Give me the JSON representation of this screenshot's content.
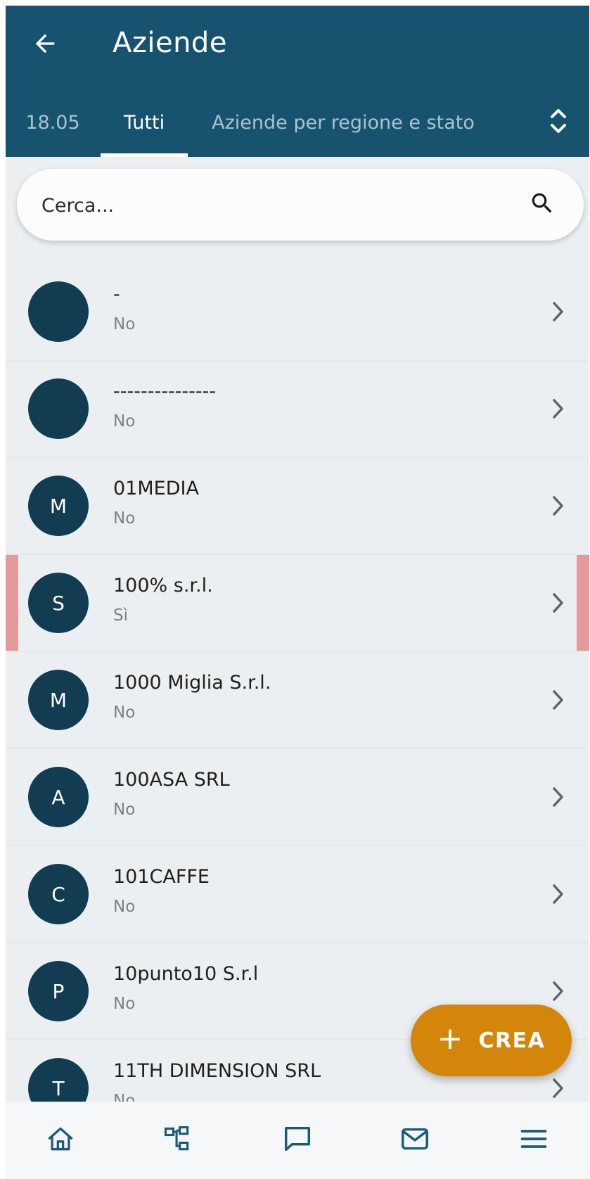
{
  "header": {
    "title": "Aziende",
    "back_icon": "arrow-left-icon"
  },
  "tabs": [
    {
      "label": "18.05",
      "active": false
    },
    {
      "label": "Tutti",
      "active": true
    },
    {
      "label": "Aziende per regione e stato",
      "active": false
    }
  ],
  "tab_sort_icon": "unfold-chevrons-icon",
  "search": {
    "placeholder": "Cerca...",
    "value": "",
    "icon": "search-icon"
  },
  "list": [
    {
      "avatar": "",
      "name": "-",
      "sub": "No",
      "flagged": false
    },
    {
      "avatar": "",
      "name": "---------------",
      "sub": "No",
      "flagged": false
    },
    {
      "avatar": "M",
      "name": "01MEDIA",
      "sub": "No",
      "flagged": false
    },
    {
      "avatar": "S",
      "name": "100% s.r.l.",
      "sub": "Sì",
      "flagged": true
    },
    {
      "avatar": "M",
      "name": "1000 Miglia S.r.l.",
      "sub": "No",
      "flagged": false
    },
    {
      "avatar": "A",
      "name": "100ASA SRL",
      "sub": "No",
      "flagged": false
    },
    {
      "avatar": "C",
      "name": "101CAFFE",
      "sub": "No",
      "flagged": false
    },
    {
      "avatar": "P",
      "name": "10punto10 S.r.l",
      "sub": "No",
      "flagged": false
    },
    {
      "avatar": "T",
      "name": "11TH DIMENSION SRL",
      "sub": "No",
      "flagged": false
    }
  ],
  "fab": {
    "label": "CREA",
    "icon": "plus-icon"
  },
  "bottom_nav": [
    {
      "name": "home",
      "icon": "home-icon"
    },
    {
      "name": "hierarchy",
      "icon": "hierarchy-icon"
    },
    {
      "name": "chat",
      "icon": "chat-icon"
    },
    {
      "name": "mail",
      "icon": "mail-icon"
    },
    {
      "name": "menu",
      "icon": "menu-icon"
    }
  ],
  "colors": {
    "header_bg": "#17536f",
    "avatar_bg": "#113c52",
    "fab_bg": "#d4860b",
    "flag_marker": "#e59a9a",
    "list_bg": "#eceff1"
  }
}
